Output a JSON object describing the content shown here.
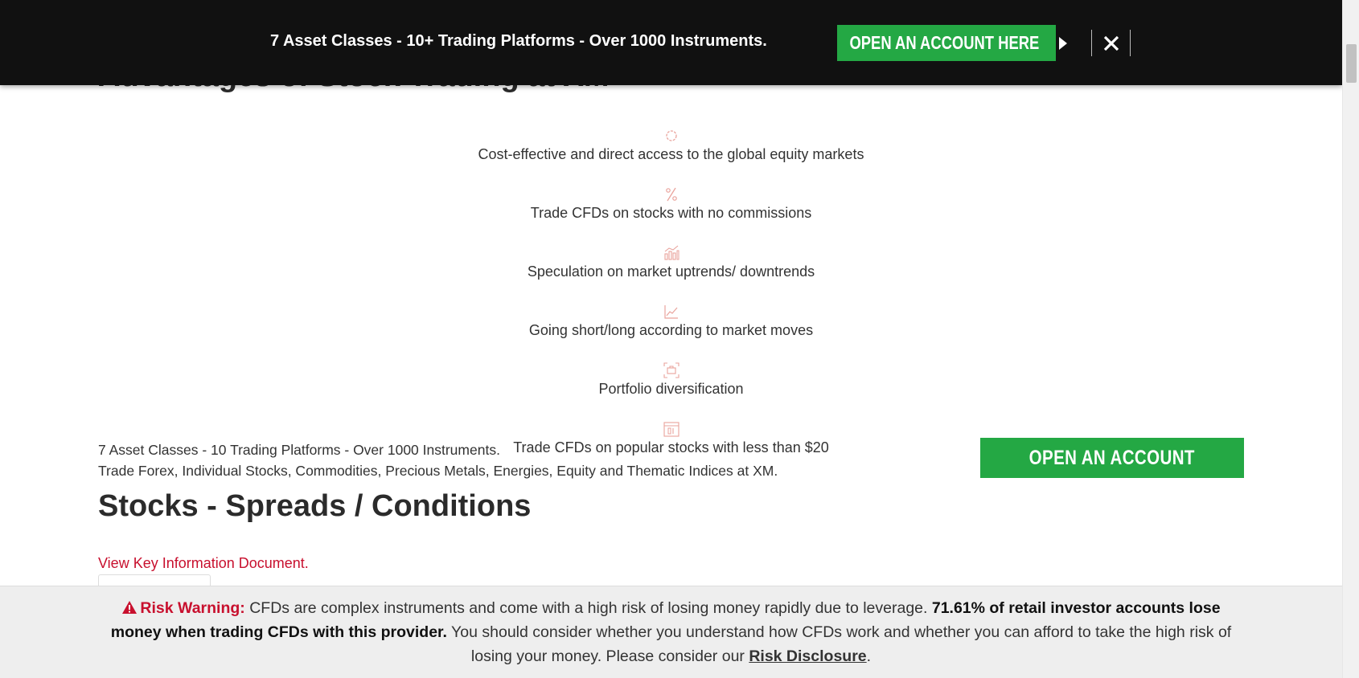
{
  "top_bar": {
    "text": "7 Asset Classes - 10+ Trading Platforms - Over 1000 Instruments.",
    "button_label": "OPEN AN ACCOUNT HERE"
  },
  "section": {
    "partial_heading": "Advantages of Stock Trading at XM"
  },
  "advantages": [
    {
      "icon": "globe-icon",
      "text": "Cost-effective and direct access to the global equity markets"
    },
    {
      "icon": "percent-icon",
      "text": "Trade CFDs on stocks with no commissions"
    },
    {
      "icon": "bar-chart-icon",
      "text": "Speculation on market uptrends/ downtrends"
    },
    {
      "icon": "line-chart-icon",
      "text": "Going short/long according to market moves"
    },
    {
      "icon": "portfolio-icon",
      "text": "Portfolio diversification"
    },
    {
      "icon": "calendar-icon",
      "text": "Trade CFDs on popular stocks with less than $20"
    }
  ],
  "promo": {
    "line1": "7 Asset Classes - 10 Trading Platforms - Over 1000 Instruments.",
    "line2": "Trade Forex, Individual Stocks, Commodities, Precious Metals, Energies, Equity and Thematic Indices at XM.",
    "button_label": "OPEN AN ACCOUNT"
  },
  "spreads": {
    "heading": "Stocks - Spreads / Conditions",
    "kid_link": "View Key Information Document."
  },
  "risk_warning": {
    "label": "Risk Warning:",
    "text1": " CFDs are complex instruments and come with a high risk of losing money rapidly due to leverage. ",
    "bold": "71.61% of retail investor accounts lose money when trading CFDs with this provider.",
    "text2": " You should consider whether you understand how CFDs work and whether you can afford to take the high risk of losing your money. Please consider our ",
    "link": "Risk Disclosure",
    "end": "."
  },
  "colors": {
    "brand_green": "#24a844",
    "accent_red": "#c8102e",
    "top_bar_bg": "#111111"
  }
}
